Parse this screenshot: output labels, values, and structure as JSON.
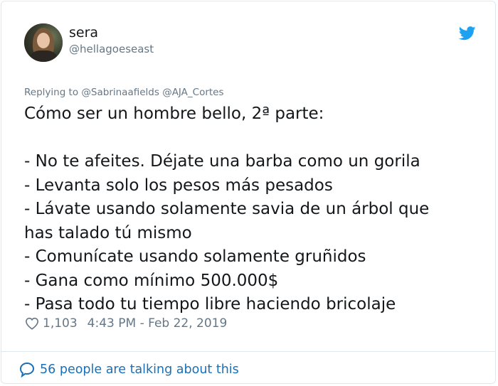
{
  "author": {
    "name": "sera",
    "handle": "@hellagoeseast"
  },
  "reply": {
    "prefix": "Replying to",
    "mentions": [
      "@Sabrinaafields",
      "@AJA_Cortes"
    ]
  },
  "tweet": {
    "title": "Cómo ser un hombre bello, 2ª parte:",
    "lines": [
      "- No te afeites. Déjate una barba como un gorila",
      "- Levanta solo los pesos más pesados",
      "- Lávate usando solamente savia de un árbol que",
      "has talado tú mismo",
      "- Comunícate usando solamente gruñidos",
      "- Gana como mínimo 500.000$",
      "- Pasa todo tu tiempo libre haciendo bricolaje"
    ]
  },
  "meta": {
    "likes": "1,103",
    "timestamp": "4:43 PM - Feb 22, 2019"
  },
  "footer": {
    "talking": "56 people are talking about this"
  },
  "icons": {
    "brand": "twitter-bird-icon",
    "like": "heart-icon",
    "reply": "speech-bubble-icon"
  },
  "colors": {
    "brand": "#1da1f2",
    "link": "#1b6fb5",
    "muted": "#657786"
  }
}
